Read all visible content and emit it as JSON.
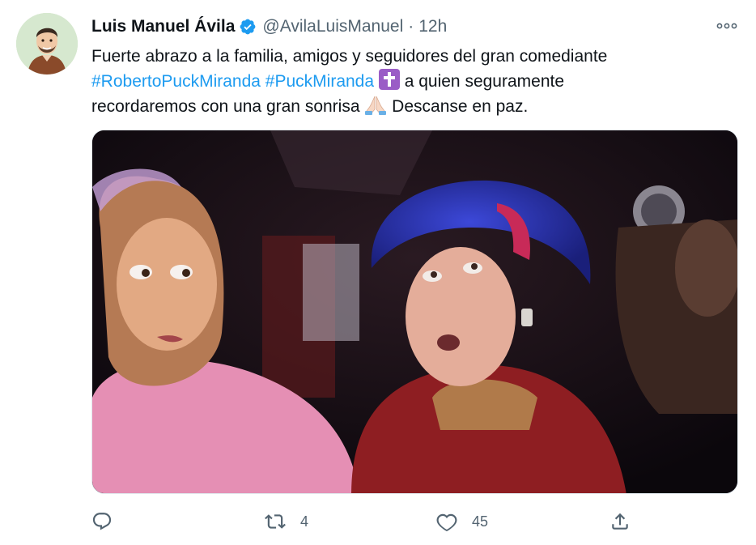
{
  "tweet": {
    "author_name": "Luis Manuel Ávila",
    "author_handle": "@AvilaLuisManuel",
    "separator": "·",
    "time": "12h",
    "text_line1": "Fuerte abrazo a la familia, amigos y seguidores del gran comediante",
    "hashtag1": "#RobertoPuckMiranda",
    "hashtag2": "#PuckMiranda",
    "text_line2_rest": " a quien seguramente",
    "text_line3a": "recordaremos con una gran sonrisa ",
    "text_line3b": " Descanse en paz.",
    "emoji_cross": "latin-cross-emoji",
    "emoji_pray": "folded-hands-emoji"
  },
  "actions": {
    "reply_icon": "reply-icon",
    "retweet_icon": "retweet-icon",
    "retweet_count": "4",
    "like_icon": "heart-icon",
    "like_count": "45",
    "share_icon": "share-icon"
  },
  "colors": {
    "link": "#1d9bf0",
    "secondary_text": "#536471",
    "verified": "#1d9bf0"
  }
}
